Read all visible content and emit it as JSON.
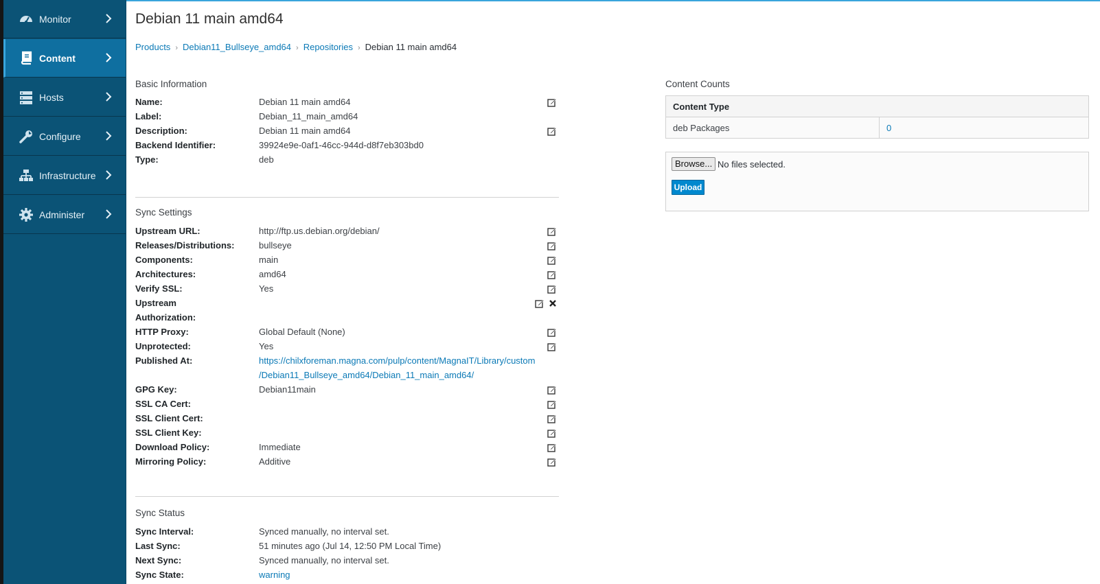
{
  "nav": {
    "items": [
      {
        "label": "Monitor",
        "icon": "dashboard-icon"
      },
      {
        "label": "Content",
        "icon": "book-icon",
        "active": true
      },
      {
        "label": "Hosts",
        "icon": "server-icon"
      },
      {
        "label": "Configure",
        "icon": "wrench-icon"
      },
      {
        "label": "Infrastructure",
        "icon": "network-icon"
      },
      {
        "label": "Administer",
        "icon": "gear-icon"
      }
    ]
  },
  "page": {
    "title": "Debian 11 main amd64",
    "breadcrumb": [
      "Products",
      "Debian11_Bullseye_amd64",
      "Repositories",
      "Debian 11 main amd64"
    ]
  },
  "basic": {
    "title": "Basic Information",
    "name_label": "Name:",
    "name": "Debian 11 main amd64",
    "label_label": "Label:",
    "label": "Debian_11_main_amd64",
    "description_label": "Description:",
    "description": "Debian 11 main amd64",
    "backend_label": "Backend Identifier:",
    "backend": "39924e9e-0af1-46cc-944d-d8f7eb303bd0",
    "type_label": "Type:",
    "type": "deb"
  },
  "sync_settings": {
    "title": "Sync Settings",
    "upstream_url_label": "Upstream URL:",
    "upstream_url": "http://ftp.us.debian.org/debian/",
    "releases_label": "Releases/Distributions:",
    "releases": "bullseye",
    "components_label": "Components:",
    "components": "main",
    "architectures_label": "Architectures:",
    "architectures": "amd64",
    "verify_ssl_label": "Verify SSL:",
    "verify_ssl": "Yes",
    "upstream_auth_label_1": "Upstream",
    "upstream_auth_label_2": "Authorization:",
    "http_proxy_label": "HTTP Proxy:",
    "http_proxy": "Global Default (None)",
    "unprotected_label": "Unprotected:",
    "unprotected": "Yes",
    "published_at_label": "Published At:",
    "published_at_1": "https://chilxforeman.magna.com/pulp/content/MagnaIT/Library/custom",
    "published_at_2": "/Debian11_Bullseye_amd64/Debian_11_main_amd64/",
    "gpg_key_label": "GPG Key:",
    "gpg_key": "Debian11main",
    "ssl_ca_label": "SSL CA Cert:",
    "ssl_client_cert_label": "SSL Client Cert:",
    "ssl_client_key_label": "SSL Client Key:",
    "download_policy_label": "Download Policy:",
    "download_policy": "Immediate",
    "mirroring_policy_label": "Mirroring Policy:",
    "mirroring_policy": "Additive"
  },
  "sync_status": {
    "title": "Sync Status",
    "interval_label": "Sync Interval:",
    "interval": "Synced manually, no interval set.",
    "last_label": "Last Sync:",
    "last": "51 minutes ago (Jul 14, 12:50 PM Local Time)",
    "next_label": "Next Sync:",
    "next": "Synced manually, no interval set.",
    "state_label": "Sync State:",
    "state": "warning"
  },
  "counts": {
    "title": "Content Counts",
    "header": "Content Type",
    "rows": [
      {
        "type": "deb Packages",
        "count": "0"
      }
    ]
  },
  "upload": {
    "browse_label": "Browse...",
    "no_files": "No files selected.",
    "upload_label": "Upload"
  },
  "colors": {
    "sidebar": "#0b5376",
    "active": "#0f6fa0",
    "link": "#0a79b6",
    "primary_button": "#0088ce"
  }
}
